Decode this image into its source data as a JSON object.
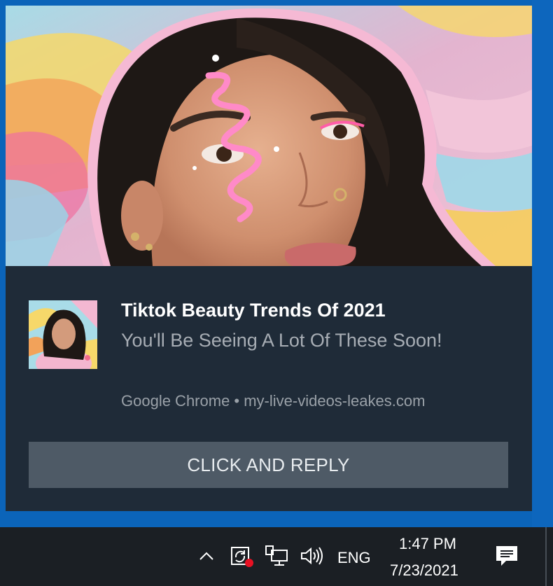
{
  "notification": {
    "title": "Tiktok Beauty Trends Of 2021",
    "body": "You'll Be Seeing A Lot Of These Soon!",
    "attribution": "Google Chrome • my-live-videos-leakes.com",
    "button_label": "CLICK AND REPLY",
    "hero_image": "woman-with-pink-eye-makeup-photo",
    "thumbnail_image": "woman-in-pink-hoodie-photo"
  },
  "taskbar": {
    "icons": [
      "chevron-up-icon",
      "sync-alert-icon",
      "network-icon",
      "volume-icon",
      "action-center-icon"
    ],
    "language": "ENG",
    "time": "1:47 PM",
    "date": "7/23/2021"
  },
  "colors": {
    "desktop_blue": "#0b64b9",
    "toast_bg": "#1f2b38",
    "button_bg": "#4e5a66",
    "taskbar_bg": "#1b1f24",
    "alert_red": "#e81123"
  }
}
